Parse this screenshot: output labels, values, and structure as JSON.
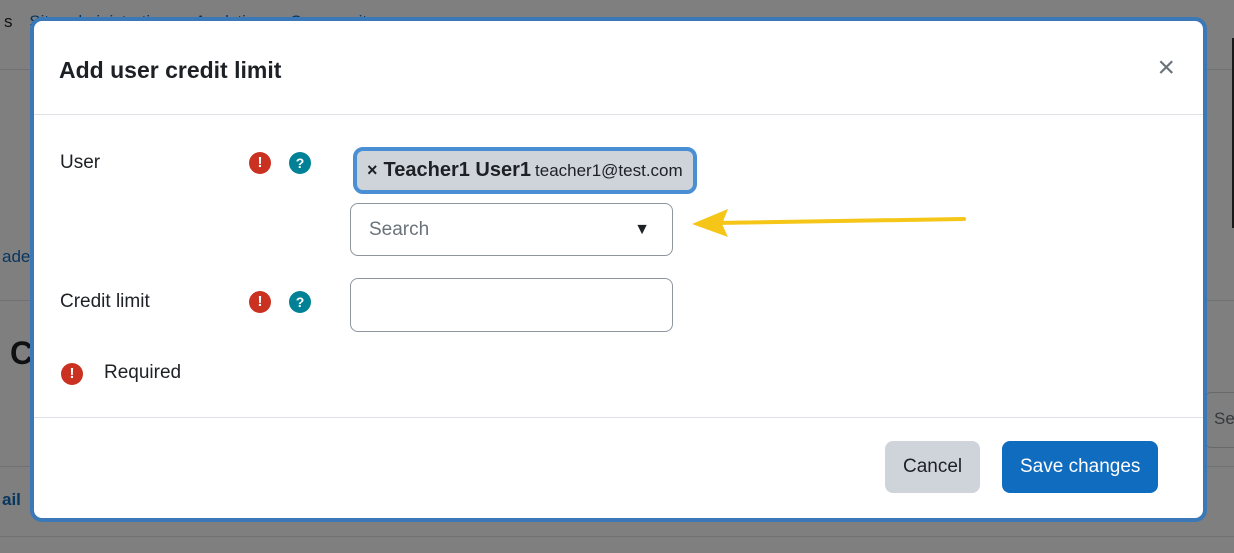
{
  "background": {
    "nav_partial_first": "s",
    "nav_items": [
      "Site administration",
      "Analytics",
      "Community"
    ],
    "frag_left_1": "ade",
    "frag_left_2": "ail",
    "heading_fragment": "C",
    "right_input_fragment": "Se"
  },
  "modal": {
    "title": "Add user credit limit",
    "close_glyph": "×",
    "user_label": "User",
    "selected_user": {
      "remove_glyph": "×",
      "name": "Teacher1 User1",
      "email": "teacher1@test.com"
    },
    "search_placeholder": "Search",
    "search_caret": "▼",
    "credit_limit_label": "Credit limit",
    "credit_limit_value": "",
    "required_label": "Required",
    "required_icon_glyph": "!",
    "help_icon_glyph": "?",
    "cancel_label": "Cancel",
    "save_label": "Save changes"
  },
  "colors": {
    "primary": "#0f6cbf",
    "required": "#ca3120",
    "help": "#008196",
    "annotation_arrow": "#f5c518"
  }
}
